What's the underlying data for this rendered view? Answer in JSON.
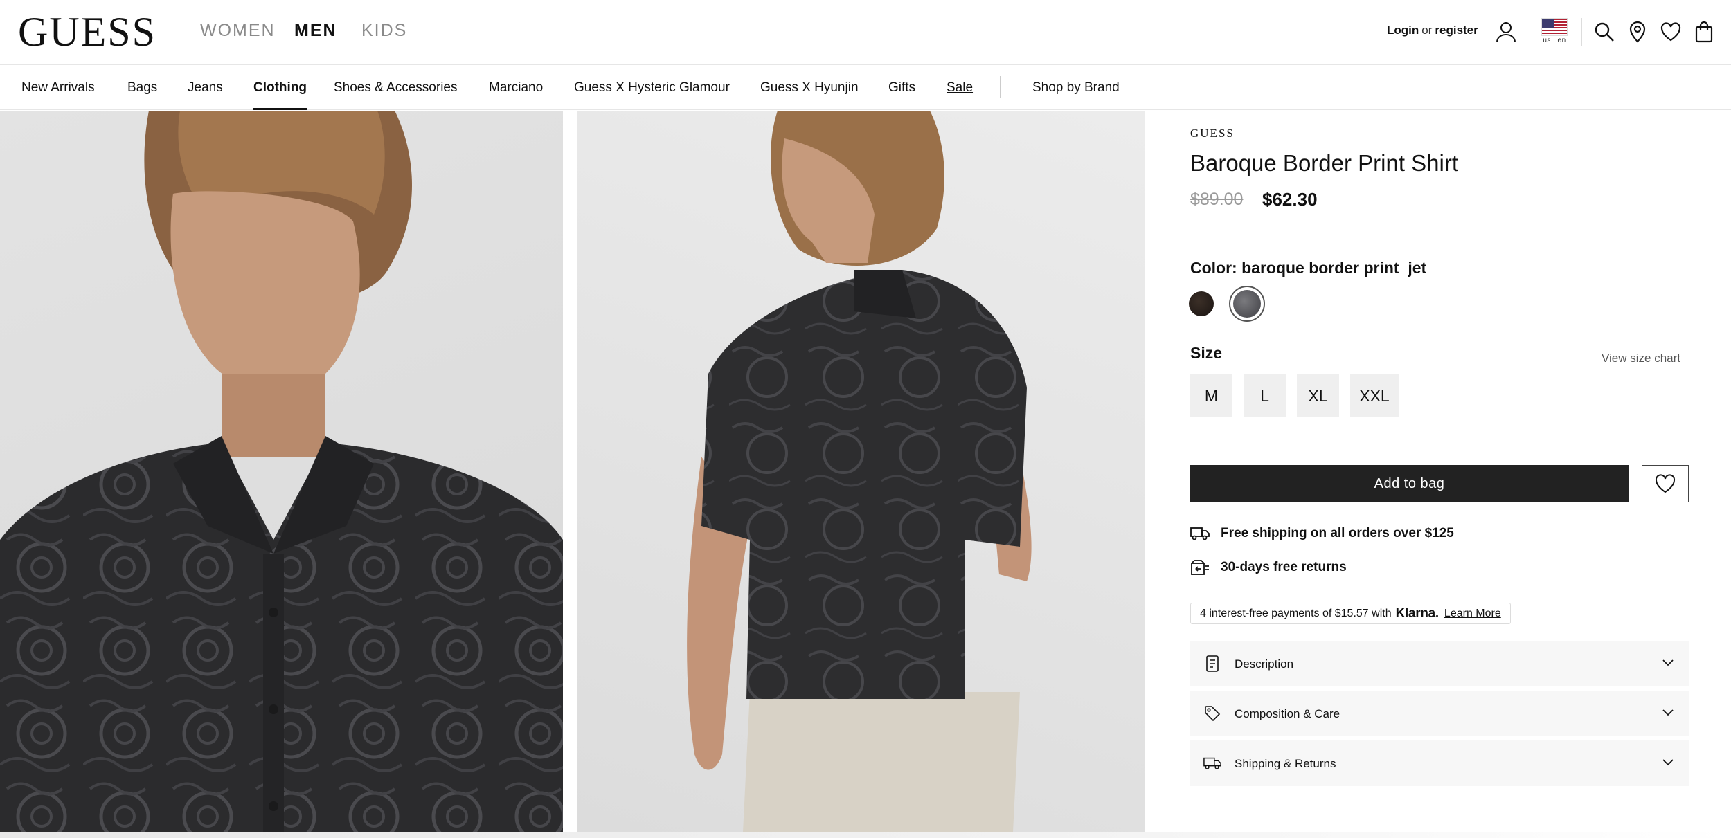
{
  "header": {
    "logo": "GUESS",
    "departments": [
      "WOMEN",
      "MEN",
      "KIDS"
    ],
    "active_department": "MEN",
    "login_label": "Login",
    "or_label": "or",
    "register_label": "register",
    "locale_label": "us | en"
  },
  "categories": [
    "New Arrivals",
    "Bags",
    "Jeans",
    "Clothing",
    "Shoes & Accessories",
    "Marciano",
    "Guess X Hysteric Glamour",
    "Guess X Hyunjin",
    "Gifts",
    "Sale",
    "Shop by Brand"
  ],
  "active_category": "Clothing",
  "product": {
    "brand": "GUESS",
    "title": "Baroque Border Print Shirt",
    "price_original": "$89.00",
    "price_sale": "$62.30",
    "color_label": "Color:",
    "color_value": "baroque border print_jet",
    "swatch_colors": [
      "#2a201b",
      "#5a5a5e"
    ],
    "size_label": "Size",
    "size_chart_label": "View size chart",
    "sizes": [
      "M",
      "L",
      "XL",
      "XXL"
    ],
    "add_to_bag_label": "Add to bag"
  },
  "perks": {
    "shipping": "Free shipping on all orders over $125",
    "returns": "30-days free returns"
  },
  "klarna": {
    "text": "4 interest-free payments of $15.57 with",
    "brand": "Klarna.",
    "learn_more": "Learn More"
  },
  "accordion": [
    {
      "label": "Description",
      "icon": "document-icon"
    },
    {
      "label": "Composition & Care",
      "icon": "tag-icon"
    },
    {
      "label": "Shipping & Returns",
      "icon": "truck-icon"
    }
  ],
  "colors": {
    "text": "#111111",
    "muted": "#8a8a8a",
    "button_dark": "#222222",
    "size_bg": "#efefef",
    "accordion_bg": "#f7f7f7",
    "shirt": "#2c2c2e"
  }
}
